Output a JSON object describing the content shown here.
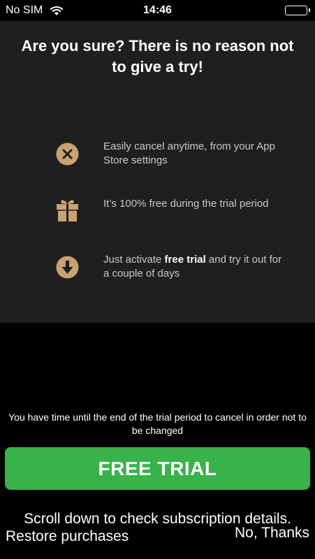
{
  "status_bar": {
    "carrier": "No SIM",
    "time": "14:46",
    "battery_level": 0
  },
  "title": "Are you sure? There is no reason not to give a try!",
  "features": [
    {
      "icon": "x-circle-icon",
      "text": "Easily cancel anytime, from your App Store settings"
    },
    {
      "icon": "gift-icon",
      "text": "It’s 100% free during the trial period"
    },
    {
      "icon": "arrow-down-circle-icon",
      "text_before": "Just activate ",
      "text_bold": "free trial",
      "text_after": " and try it out for a couple of days"
    }
  ],
  "notice": "You have time until the end of the trial period to cancel in order not to be changed",
  "cta_label": "FREE TRIAL",
  "scroll_hint": "Scroll down to check subscription details.",
  "restore_label": "Restore purchases",
  "no_thanks_label": "No, Thanks",
  "colors": {
    "accent_tan": "#c8a272",
    "cta_green": "#37b34a",
    "panel": "#1f1f1f",
    "background": "#000000"
  }
}
